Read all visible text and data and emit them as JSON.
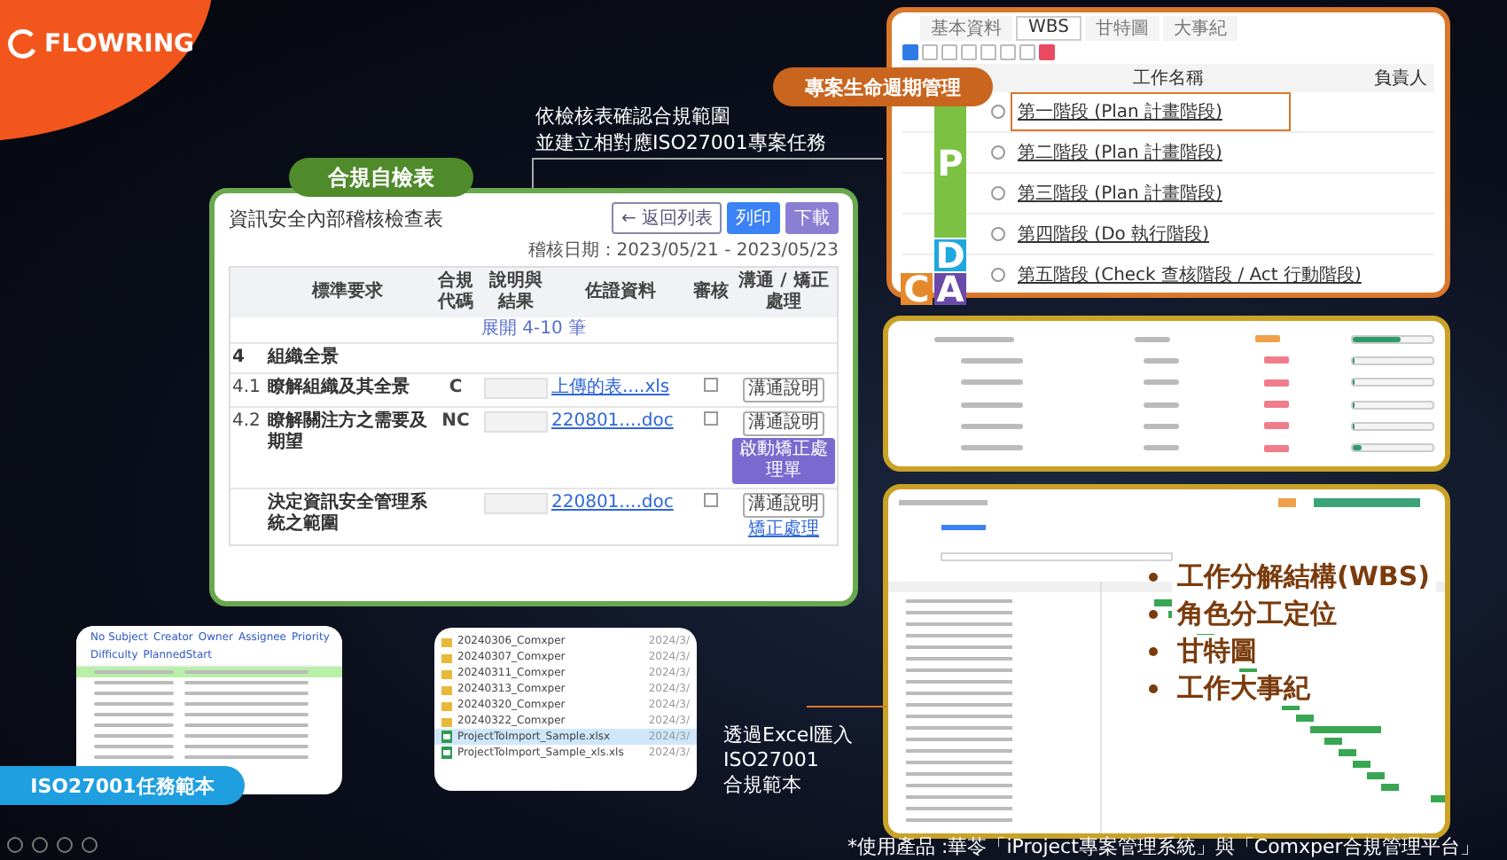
{
  "logo": {
    "text": "FLOWRING"
  },
  "annotation": {
    "lines": [
      "依檢核表確認合規範圍",
      "並建立相對應ISO27001專案任務"
    ]
  },
  "compliance_panel": {
    "badge": "合規自檢表",
    "title": "資訊安全內部稽核檢查表",
    "buttons": [
      "← 返回列表",
      "列印",
      "下載"
    ],
    "audit_date": "稽核日期：2023/05/21 - 2023/05/23",
    "columns": [
      "標準要求",
      "合規代碼",
      "說明與結果",
      "佐證資料",
      "審核",
      "溝通 / 矯正處理"
    ],
    "expand_link": "展開 4-10 筆",
    "section": {
      "number": "4",
      "title": "組織全景"
    },
    "rows": [
      {
        "number": "4.1",
        "title": "瞭解組織及其全景",
        "code": "C",
        "evidence": "上傳的表....xls",
        "reviewed": false,
        "actions": [
          {
            "kind": "outline",
            "label": "溝通說明"
          }
        ]
      },
      {
        "number": "4.2",
        "title": "瞭解關注方之需要及期望",
        "code": "NC",
        "evidence": "220801....doc",
        "reviewed": false,
        "actions": [
          {
            "kind": "outline",
            "label": "溝通說明"
          },
          {
            "kind": "solid",
            "label": "啟動矯正處理單"
          }
        ]
      },
      {
        "number": "",
        "title": "決定資訊安全管理系統之範圍",
        "code": "",
        "evidence": "220801....doc",
        "reviewed": false,
        "actions": [
          {
            "kind": "outline",
            "label": "溝通說明"
          },
          {
            "kind": "link",
            "label": "矯正處理"
          }
        ]
      }
    ]
  },
  "lifecycle_panel": {
    "badge": "專案生命週期管理",
    "tabs": [
      {
        "label": "基本資料",
        "selected": false
      },
      {
        "label": "WBS",
        "selected": true
      },
      {
        "label": "甘特圖",
        "selected": false
      },
      {
        "label": "大事紀",
        "selected": false
      }
    ],
    "columns": [
      "工作名稱",
      "負責人"
    ],
    "phases": [
      {
        "letter": "P",
        "color": "#7dc142"
      },
      {
        "letter": "D",
        "color": "#1fa8e0"
      },
      {
        "letter": "C",
        "color": "#e58a2c"
      },
      {
        "letter": "A",
        "color": "#6a4aa8"
      }
    ],
    "rows": [
      {
        "name": "第一階段 (Plan 計畫階段)",
        "highlighted": true
      },
      {
        "name": "第二階段 (Plan 計畫階段)",
        "highlighted": false
      },
      {
        "name": "第三階段 (Plan 計畫階段)",
        "highlighted": false
      },
      {
        "name": "第四階段 (Do 執行階段)",
        "highlighted": false
      },
      {
        "name": "第五階段 (Check 查核階段 / Act 行動階段)",
        "highlighted": false
      }
    ]
  },
  "progress_panel": {
    "rows": [
      {
        "color": "#f0a04b",
        "level": 0.6
      },
      {
        "color": "#f07c8c",
        "level": 0.03
      },
      {
        "color": "#f07c8c",
        "level": 0
      },
      {
        "color": "#f07c8c",
        "level": 0
      },
      {
        "color": "#f07c8c",
        "level": 0
      },
      {
        "color": "#f07c8c",
        "level": 0.1
      }
    ]
  },
  "gantt_panel": {
    "features": [
      "工作分解結構(WBS)",
      "角色分工定位",
      "甘特圖",
      "工作大事紀"
    ]
  },
  "excel_panel": {
    "headers": [
      "No Subject",
      "Creator",
      "Owner",
      "Assignee",
      "Priority",
      "Difficulty",
      "PlannedStart"
    ],
    "badge": "ISO27001任務範本"
  },
  "file_panel": {
    "files": [
      {
        "kind": "folder",
        "name": "20240306_Comxper",
        "date": "2024/3/",
        "selected": false
      },
      {
        "kind": "folder",
        "name": "20240307_Comxper",
        "date": "2024/3/",
        "selected": false
      },
      {
        "kind": "folder",
        "name": "20240311_Comxper",
        "date": "2024/3/",
        "selected": false
      },
      {
        "kind": "folder",
        "name": "20240313_Comxper",
        "date": "2024/3/",
        "selected": false
      },
      {
        "kind": "folder",
        "name": "20240320_Comxper",
        "date": "2024/3/",
        "selected": false
      },
      {
        "kind": "folder",
        "name": "20240322_Comxper",
        "date": "2024/3/",
        "selected": false
      },
      {
        "kind": "sheet",
        "name": "ProjectToImport_Sample.xlsx",
        "date": "2024/3/",
        "selected": true
      },
      {
        "kind": "sheet",
        "name": "ProjectToImport_Sample_xls.xls",
        "date": "2024/3/",
        "selected": false
      }
    ]
  },
  "import_note": {
    "lines": [
      "透過Excel匯入",
      "ISO27001",
      "合規範本"
    ]
  },
  "footer": "*使用產品 :華苓「iProject專案管理系統」與「Comxper合規管理平台」"
}
